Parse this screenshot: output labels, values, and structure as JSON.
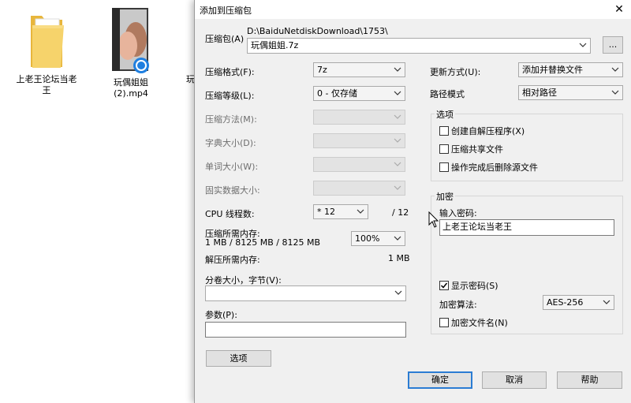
{
  "desktop": {
    "items": [
      {
        "label": "上老王论坛当老\n王",
        "icon": "folder-icon"
      },
      {
        "label": "玩偶姐姐\n(2).mp4",
        "icon": "video-file-icon"
      },
      {
        "label": "玩",
        "icon": "file-icon"
      }
    ]
  },
  "dialog": {
    "title": "添加到压缩包",
    "close_symbol": "✕",
    "archive": {
      "label": "压缩包(A)",
      "path": "D:\\BaiduNetdiskDownload\\1753\\",
      "filename": "玩偶姐姐.7z",
      "browse_label": "..."
    },
    "left": {
      "format_label": "压缩格式(F):",
      "format_value": "7z",
      "level_label": "压缩等级(L):",
      "level_value": "0 - 仅存储",
      "method_label": "压缩方法(M):",
      "dict_label": "字典大小(D):",
      "word_label": "单词大小(W):",
      "solid_label": "固实数据大小:",
      "cpu_label": "CPU 线程数:",
      "cpu_value": "* 12",
      "cpu_total": "/ 12",
      "mem_compress_label": "压缩所需内存:",
      "mem_compress_value": "1 MB / 8125 MB / 8125 MB",
      "mem_percent": "100%",
      "mem_decompress_label": "解压所需内存:",
      "mem_decompress_value": "1 MB",
      "volume_label": "分卷大小，字节(V):",
      "volume_value": "",
      "params_label": "参数(P):",
      "params_value": "",
      "options_button": "选项"
    },
    "right": {
      "update_label": "更新方式(U):",
      "update_value": "添加并替换文件",
      "path_label": "路径模式",
      "path_value": "相对路径",
      "options_group": "选项",
      "opt_sfx": "创建自解压程序(X)",
      "opt_shared": "压缩共享文件",
      "opt_delete": "操作完成后删除源文件",
      "encrypt_group": "加密",
      "password_label": "输入密码:",
      "password_value": "上老王论坛当老王",
      "show_password": "显示密码(S)",
      "method_label": "加密算法:",
      "method_value": "AES-256",
      "encrypt_names": "加密文件名(N)"
    },
    "buttons": {
      "ok": "确定",
      "cancel": "取消",
      "help": "帮助"
    }
  }
}
